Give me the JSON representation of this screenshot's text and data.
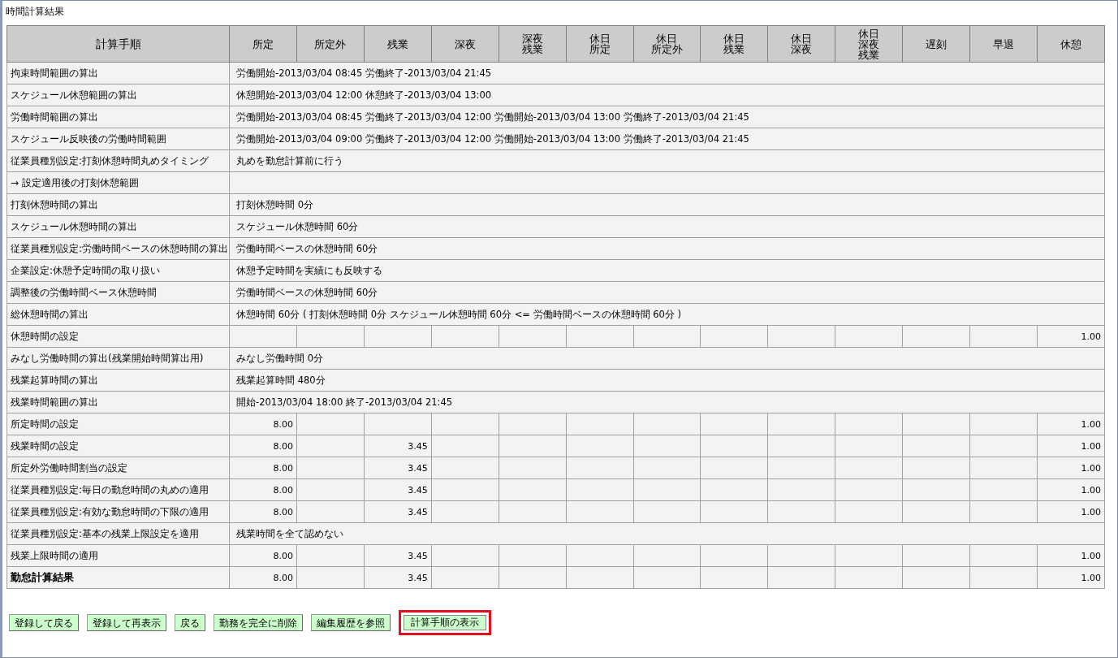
{
  "title": "時間計算結果",
  "table": {
    "columns": [
      {
        "lines": [
          "計算手順"
        ]
      },
      {
        "lines": [
          "所定"
        ]
      },
      {
        "lines": [
          "所定外"
        ]
      },
      {
        "lines": [
          "残業"
        ]
      },
      {
        "lines": [
          "深夜"
        ]
      },
      {
        "lines": [
          "深夜",
          "残業"
        ]
      },
      {
        "lines": [
          "休日",
          "所定"
        ]
      },
      {
        "lines": [
          "休日",
          "所定外"
        ]
      },
      {
        "lines": [
          "休日",
          "残業"
        ]
      },
      {
        "lines": [
          "休日",
          "深夜"
        ]
      },
      {
        "lines": [
          "休日",
          "深夜",
          "残業"
        ]
      },
      {
        "lines": [
          "遅刻"
        ]
      },
      {
        "lines": [
          "早退"
        ]
      },
      {
        "lines": [
          "休憩"
        ]
      }
    ],
    "rows": [
      {
        "step": "拘束時間範囲の算出",
        "kind": "note",
        "note": "労働開始-2013/03/04 08:45  労働終了-2013/03/04 21:45",
        "emphasized": false
      },
      {
        "step": "スケジュール休憩範囲の算出",
        "kind": "note",
        "note": "休憩開始-2013/03/04 12:00  休憩終了-2013/03/04 13:00",
        "emphasized": false
      },
      {
        "step": "労働時間範囲の算出",
        "kind": "note",
        "note": "労働開始-2013/03/04 08:45  労働終了-2013/03/04 12:00  労働開始-2013/03/04 13:00  労働終了-2013/03/04 21:45",
        "emphasized": false
      },
      {
        "step": "スケジュール反映後の労働時間範囲",
        "kind": "note",
        "note": "労働開始-2013/03/04 09:00  労働終了-2013/03/04 12:00  労働開始-2013/03/04 13:00  労働終了-2013/03/04 21:45",
        "emphasized": false
      },
      {
        "step": "従業員種別設定:打刻休憩時間丸めタイミング",
        "kind": "note",
        "note": "丸めを勤怠計算前に行う",
        "emphasized": false
      },
      {
        "step": "→ 設定適用後の打刻休憩範囲",
        "kind": "note",
        "emphasized": false
      },
      {
        "step": "打刻休憩時間の算出",
        "kind": "note",
        "note": "打刻休憩時間 0分",
        "emphasized": false
      },
      {
        "step": "スケジュール休憩時間の算出",
        "kind": "note",
        "note": "スケジュール休憩時間 60分",
        "emphasized": false
      },
      {
        "step": "従業員種別設定:労働時間ベースの休憩時間の算出",
        "kind": "note",
        "note": "労働時間ベースの休憩時間 60分",
        "emphasized": false
      },
      {
        "step": "企業設定:休憩予定時間の取り扱い",
        "kind": "note",
        "note": "休憩予定時間を実績にも反映する",
        "emphasized": false
      },
      {
        "step": "調整後の労働時間ベース休憩時間",
        "kind": "note",
        "note": "労働時間ベースの休憩時間 60分",
        "emphasized": false
      },
      {
        "step": "総休憩時間の算出",
        "kind": "note",
        "note": "休憩時間 60分 ( 打刻休憩時間 0分    スケジュール休憩時間 60分 <= 労働時間ベースの休憩時間 60分 )",
        "emphasized": false
      },
      {
        "step": "休憩時間の設定",
        "kind": "values",
        "values": {
          "break": "1.00"
        },
        "emphasized": false
      },
      {
        "step": "みなし労働時間の算出(残業開始時間算出用)",
        "kind": "note",
        "note": "みなし労働時間 0分",
        "emphasized": false
      },
      {
        "step": "残業起算時間の算出",
        "kind": "note",
        "note": "残業起算時間 480分",
        "emphasized": false
      },
      {
        "step": "残業時間範囲の算出",
        "kind": "note",
        "note": "開始-2013/03/04 18:00  終了-2013/03/04 21:45",
        "emphasized": false
      },
      {
        "step": "所定時間の設定",
        "kind": "values",
        "values": {
          "scheduled": "8.00",
          "break": "1.00"
        },
        "emphasized": false
      },
      {
        "step": "残業時間の設定",
        "kind": "values",
        "values": {
          "scheduled": "8.00",
          "overtime": "3.45",
          "break": "1.00"
        },
        "emphasized": false
      },
      {
        "step": "所定外労働時間割当の設定",
        "kind": "values",
        "values": {
          "scheduled": "8.00",
          "overtime": "3.45",
          "break": "1.00"
        },
        "emphasized": false
      },
      {
        "step": "従業員種別設定:毎日の勤怠時間の丸めの適用",
        "kind": "values",
        "values": {
          "scheduled": "8.00",
          "overtime": "3.45",
          "break": "1.00"
        },
        "emphasized": false
      },
      {
        "step": "従業員種別設定:有効な勤怠時間の下限の適用",
        "kind": "values",
        "values": {
          "scheduled": "8.00",
          "overtime": "3.45",
          "break": "1.00"
        },
        "emphasized": false
      },
      {
        "step": "従業員種別設定:基本の残業上限設定を適用",
        "kind": "note",
        "note": "残業時間を全て認めない",
        "emphasized": false
      },
      {
        "step": "残業上限時間の適用",
        "kind": "values",
        "values": {
          "scheduled": "8.00",
          "overtime": "3.45",
          "break": "1.00"
        },
        "emphasized": false
      },
      {
        "step": "勤怠計算結果",
        "kind": "values",
        "values": {
          "scheduled": "8.00",
          "overtime": "3.45",
          "break": "1.00"
        },
        "emphasized": true
      }
    ]
  },
  "buttons": [
    {
      "label": "登録して戻る",
      "highlighted": false
    },
    {
      "label": "登録して再表示",
      "highlighted": false
    },
    {
      "label": "戻る",
      "highlighted": false
    },
    {
      "label": "勤務を完全に削除",
      "highlighted": false
    },
    {
      "label": "編集履歴を参照",
      "highlighted": false
    },
    {
      "label": "計算手順の表示",
      "highlighted": true
    }
  ]
}
